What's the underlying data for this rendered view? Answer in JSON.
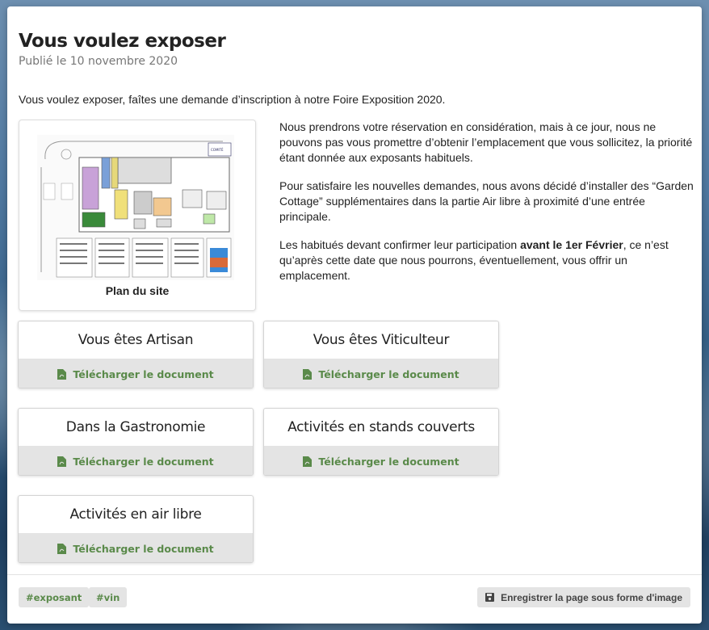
{
  "page": {
    "title": "Vous voulez exposer",
    "published": "Publié le 10 novembre 2020",
    "intro": "Vous voulez exposer, faîtes une demande d’inscription à notre Foire Exposition 2020."
  },
  "figure": {
    "caption": "Plan du site"
  },
  "paragraphs": {
    "p1": "Nous prendrons votre réservation en considération, mais à ce jour, nous ne pouvons pas vous promettre d’obtenir l’emplacement que vous sollicitez, la priorité étant donnée aux exposants habituels.",
    "p2": "Pour satisfaire les nouvelles demandes, nous avons décidé d’installer des “Garden Cottage” supplémentaires dans la partie Air libre à proximité d’une entrée principale.",
    "p3_before": "Les habitués devant confirmer leur participation ",
    "p3_bold": "avant le 1er Février",
    "p3_after": ", ce n’est qu’après cette date que nous pourrons, éventuellement, vous offrir un emplacement."
  },
  "downloads": [
    {
      "title": "Vous êtes Artisan",
      "button": "Télécharger le document"
    },
    {
      "title": "Vous êtes Viticulteur",
      "button": "Télécharger le document"
    },
    {
      "title": "Dans la Gastronomie",
      "button": "Télécharger le document"
    },
    {
      "title": "Activités en stands couverts",
      "button": "Télécharger le document"
    },
    {
      "title": "Activités en air libre",
      "button": "Télécharger le document"
    }
  ],
  "tags": [
    "#exposant",
    "#vin"
  ],
  "save_button": "Enregistrer la page sous forme d'image",
  "icons": {
    "download": "file-pdf-icon",
    "save": "floppy-disk-icon"
  },
  "colors": {
    "accent": "#5a8a4a",
    "button_bg": "#e4e4e4"
  }
}
